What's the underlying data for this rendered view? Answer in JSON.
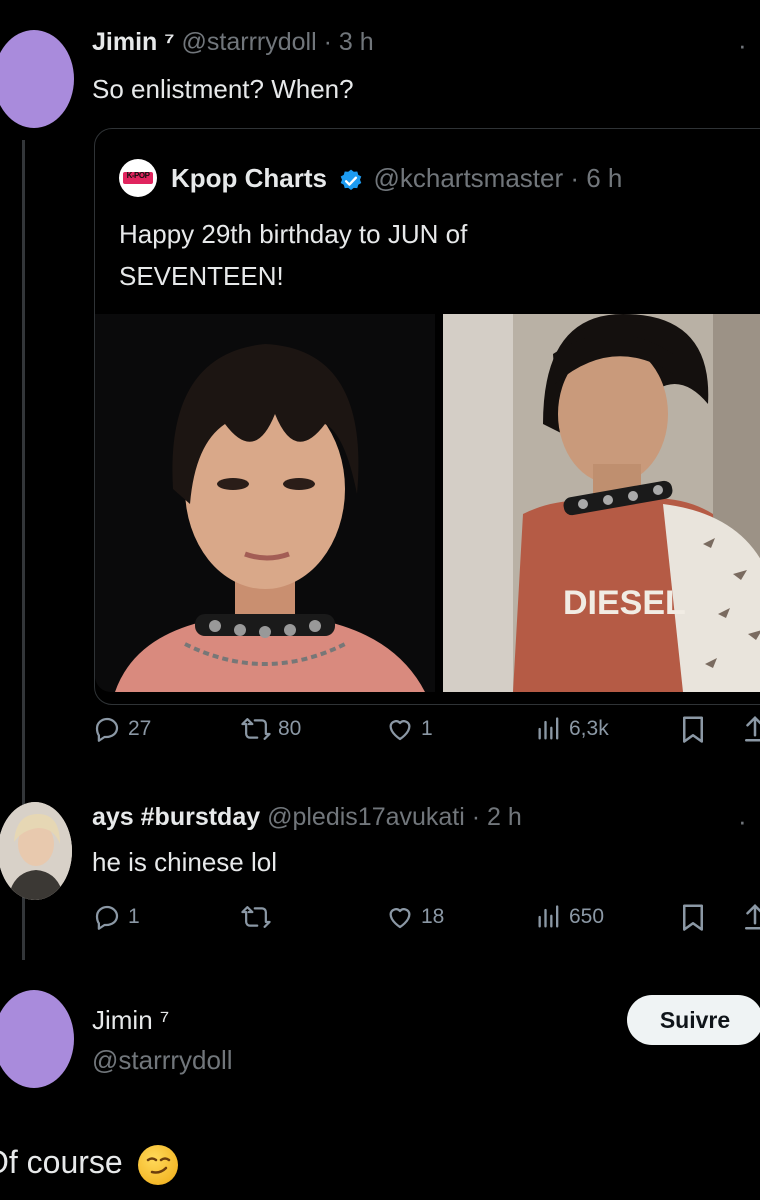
{
  "tweet1": {
    "display_name": "Jimin ⁷",
    "handle": "@starrrydoll",
    "time": "· 3 h",
    "text": "So enlistment? When?"
  },
  "quote": {
    "display_name": "Kpop Charts",
    "handle": "@kchartsmaster",
    "time": "· 6 h",
    "logo_text": "K-POP",
    "text_line1": "Happy 29th birthday to JUN of",
    "text_line2": "SEVENTEEN!",
    "shirt_text": "DIESEL"
  },
  "tweet1_actions": {
    "replies": "27",
    "retweets": "80",
    "likes": "1",
    "views": "6,3k"
  },
  "reply": {
    "display_name": "ays #burstday",
    "handle": "@pledis17avukati",
    "time": "· 2 h",
    "text": "he is chinese lol",
    "actions": {
      "replies": "1",
      "retweets": "",
      "likes": "18",
      "views": "650"
    }
  },
  "tweet3": {
    "display_name": "Jimin ⁷",
    "handle": "@starrrydoll",
    "follow_label": "Suivre",
    "text": "Of course"
  },
  "colors": {
    "background": "#000000",
    "avatar_purple": "#a98bdc",
    "verified_blue": "#1d9bf0",
    "muted": "#71767b"
  }
}
